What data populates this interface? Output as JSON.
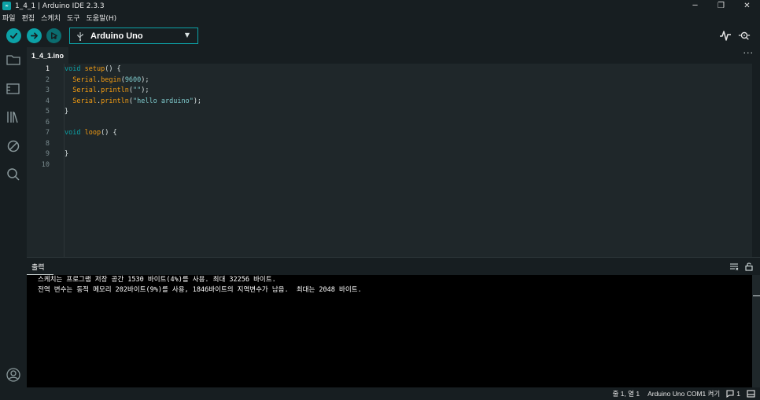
{
  "window": {
    "title": "1_4_1 | Arduino IDE 2.3.3",
    "app_icon": "arduino-logo-icon",
    "minimize_icon": "─",
    "restore_icon": "❐",
    "close_icon": "✕"
  },
  "menu": [
    "파일",
    "편집",
    "스케치",
    "도구",
    "도움말(H)"
  ],
  "toolbar": {
    "verify_icon": "check-icon",
    "upload_icon": "arrow-right-icon",
    "debug_icon": "debug-icon",
    "board": "Arduino Uno",
    "plotter_icon": "serial-plotter-icon",
    "monitor_icon": "serial-monitor-icon"
  },
  "colors": {
    "accent": "#0ca1a6",
    "background": "#171e21",
    "editor_bg": "#1f272a",
    "keyword": "#0ca1a6",
    "function": "#f39c12"
  },
  "sidebar": [
    "sketchbook-icon",
    "boards-manager-icon",
    "library-manager-icon",
    "debug-sidebar-icon",
    "search-icon",
    "account-icon"
  ],
  "tab": {
    "filename": "1_4_1.ino",
    "more": "···"
  },
  "editor": {
    "line_numbers": [
      "1",
      "2",
      "3",
      "4",
      "5",
      "6",
      "7",
      "8",
      "9",
      "10"
    ],
    "active_line": 1,
    "lines": [
      [
        {
          "t": "void",
          "c": "kw"
        },
        {
          "t": " ",
          "c": "plain"
        },
        {
          "t": "setup",
          "c": "fn"
        },
        {
          "t": "() {",
          "c": "plain"
        }
      ],
      [
        {
          "t": "  ",
          "c": "plain"
        },
        {
          "t": "Serial",
          "c": "obj"
        },
        {
          "t": ".",
          "c": "plain"
        },
        {
          "t": "begin",
          "c": "fn"
        },
        {
          "t": "(",
          "c": "plain"
        },
        {
          "t": "9600",
          "c": "num"
        },
        {
          "t": ");",
          "c": "plain"
        }
      ],
      [
        {
          "t": "  ",
          "c": "plain"
        },
        {
          "t": "Serial",
          "c": "obj"
        },
        {
          "t": ".",
          "c": "plain"
        },
        {
          "t": "println",
          "c": "fn"
        },
        {
          "t": "(",
          "c": "plain"
        },
        {
          "t": "\"\"",
          "c": "str"
        },
        {
          "t": ");",
          "c": "plain"
        }
      ],
      [
        {
          "t": "  ",
          "c": "plain"
        },
        {
          "t": "Serial",
          "c": "obj"
        },
        {
          "t": ".",
          "c": "plain"
        },
        {
          "t": "println",
          "c": "fn"
        },
        {
          "t": "(",
          "c": "plain"
        },
        {
          "t": "\"hello arduino\"",
          "c": "str"
        },
        {
          "t": ");",
          "c": "plain"
        }
      ],
      [
        {
          "t": "}",
          "c": "plain"
        }
      ],
      [],
      [
        {
          "t": "void",
          "c": "kw"
        },
        {
          "t": " ",
          "c": "plain"
        },
        {
          "t": "loop",
          "c": "fn"
        },
        {
          "t": "() {",
          "c": "plain"
        }
      ],
      [],
      [
        {
          "t": "}",
          "c": "plain"
        }
      ],
      []
    ]
  },
  "output": {
    "title": "출력",
    "lines": [
      "스케치는 프로그램 저장 공간 1530 바이트(4%)를 사용. 최대 32256 바이트.",
      "전역 변수는 동적 메모리 202바이트(9%)를 사용, 1846바이트의 지역변수가 남음.  최대는 2048 바이트."
    ]
  },
  "status": {
    "position": "줄 1, 열 1",
    "board_port": "Arduino Uno COM1 켜기",
    "notifications": "1"
  }
}
